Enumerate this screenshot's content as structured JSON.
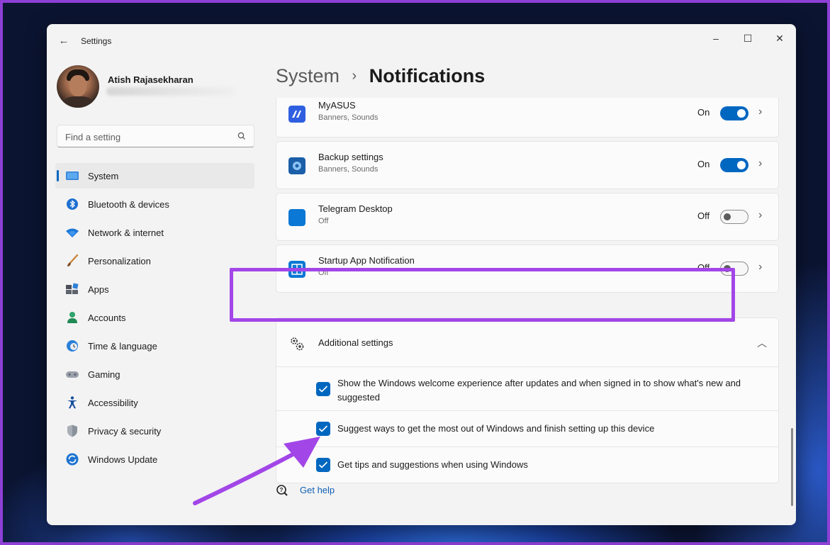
{
  "window": {
    "title": "Settings",
    "controls": {
      "minimize": "–",
      "maximize": "☐",
      "close": "✕"
    }
  },
  "profile": {
    "name": "Atish Rajasekharan"
  },
  "search": {
    "placeholder": "Find a setting"
  },
  "sidebar": {
    "items": [
      {
        "label": "System",
        "icon": "system-icon",
        "active": true
      },
      {
        "label": "Bluetooth & devices",
        "icon": "bluetooth-icon"
      },
      {
        "label": "Network & internet",
        "icon": "wifi-icon"
      },
      {
        "label": "Personalization",
        "icon": "brush-icon"
      },
      {
        "label": "Apps",
        "icon": "apps-icon"
      },
      {
        "label": "Accounts",
        "icon": "person-icon"
      },
      {
        "label": "Time & language",
        "icon": "clock-globe-icon"
      },
      {
        "label": "Gaming",
        "icon": "gamepad-icon"
      },
      {
        "label": "Accessibility",
        "icon": "accessibility-icon"
      },
      {
        "label": "Privacy & security",
        "icon": "shield-icon"
      },
      {
        "label": "Windows Update",
        "icon": "update-icon"
      }
    ]
  },
  "breadcrumb": {
    "parent": "System",
    "separator": "›",
    "current": "Notifications"
  },
  "apps": [
    {
      "name": "MyASUS",
      "sub": "Banners, Sounds",
      "state": "On",
      "on": true,
      "icon": "myasus-icon"
    },
    {
      "name": "Backup settings",
      "sub": "Banners, Sounds",
      "state": "On",
      "on": true,
      "icon": "backup-icon"
    },
    {
      "name": "Telegram Desktop",
      "sub": "Off",
      "state": "Off",
      "on": false,
      "icon": "telegram-icon"
    },
    {
      "name": "Startup App Notification",
      "sub": "Off",
      "state": "Off",
      "on": false,
      "icon": "startup-app-icon"
    }
  ],
  "additional": {
    "label": "Additional settings",
    "options": [
      {
        "text": "Show the Windows welcome experience after updates and when signed in to show what's new and suggested",
        "checked": true
      },
      {
        "text": "Suggest ways to get the most out of Windows and finish setting up this device",
        "checked": true
      },
      {
        "text": "Get tips and suggestions when using Windows",
        "checked": true
      }
    ]
  },
  "help": {
    "label": "Get help"
  },
  "colors": {
    "accent": "#0067c0",
    "highlight": "#a246e8"
  }
}
